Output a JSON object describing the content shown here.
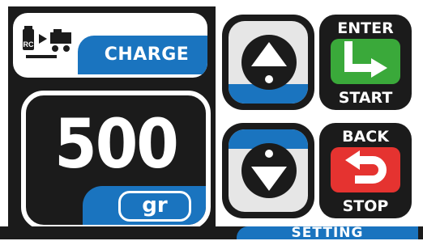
{
  "header": {
    "mode_label": "CHARGE",
    "mode_icon": "charge-icon"
  },
  "display": {
    "value": "500",
    "unit": "gr"
  },
  "buttons": {
    "up": {
      "icon": "arrow-up-icon"
    },
    "down": {
      "icon": "arrow-down-icon"
    },
    "enter": {
      "top_label": "ENTER",
      "bottom_label": "START",
      "icon": "enter-arrow-icon",
      "color": "#3aa93a"
    },
    "back": {
      "top_label": "BACK",
      "bottom_label": "STOP",
      "icon": "back-arrow-icon",
      "color": "#e53330"
    }
  },
  "footer": {
    "label": "SETTING"
  },
  "colors": {
    "accent": "#1a74bf",
    "background": "#1b1b1b"
  }
}
